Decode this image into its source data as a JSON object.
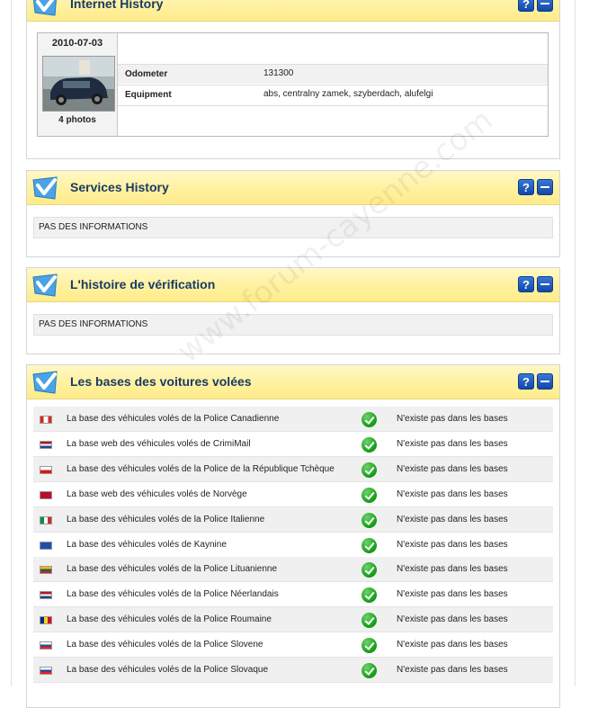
{
  "panels": {
    "internet": {
      "title": "Internet History",
      "date": "2010-07-03",
      "photos": "4 photos",
      "rows": [
        {
          "key": "Odometer",
          "value": "131300"
        },
        {
          "key": "Equipment",
          "value": "abs, centralny zamek, szyberdach, alufelgi"
        }
      ]
    },
    "services": {
      "title": "Services History",
      "info": "PAS DES INFORMATIONS"
    },
    "verification": {
      "title": "L'histoire de vérification",
      "info": "PAS DES INFORMATIONS"
    },
    "stolen": {
      "title": "Les bases des voitures volées",
      "rows": [
        {
          "flag": "canada",
          "name": "La base des véhicules volés de la Police Canadienne",
          "status": "N'existe pas dans les bases"
        },
        {
          "flag": "netherlands",
          "name": "La base web des véhicules volés de CrimiMail",
          "status": "N'existe pas dans les bases"
        },
        {
          "flag": "czech",
          "name": "La base des véhicules volés de la Police de la République Tchèque",
          "status": "N'existe pas dans les bases"
        },
        {
          "flag": "norway",
          "name": "La base web des véhicules volés de Norvège",
          "status": "N'existe pas dans les bases"
        },
        {
          "flag": "italy",
          "name": "La base des véhicules volés de la Police Italienne",
          "status": "N'existe pas dans les bases"
        },
        {
          "flag": "k9",
          "name": "La base des véhicules volés de Kaynine",
          "status": "N'existe pas dans les bases"
        },
        {
          "flag": "lithuania",
          "name": "La base des véhicules volés de la Police Lituanienne",
          "status": "N'existe pas dans les bases"
        },
        {
          "flag": "netherlands",
          "name": "La base des véhicules volés de la Police Néerlandais",
          "status": "N'existe pas dans les bases"
        },
        {
          "flag": "romania",
          "name": "La base des véhicules volés de la Police Roumaine",
          "status": "N'existe pas dans les bases"
        },
        {
          "flag": "slovenia",
          "name": "La base des véhicules volés de la Police Slovene",
          "status": "N'existe pas dans les bases"
        },
        {
          "flag": "slovakia",
          "name": "La base des véhicules volés de la Police Slovaque",
          "status": "N'existe pas dans les bases"
        }
      ]
    }
  },
  "watermark": "www.forum-cayenne.com",
  "buttons": {
    "help": "?"
  },
  "colors": {
    "title": "#1a3a66",
    "header_bg": "#fff1a0",
    "accent": "#1148a8",
    "ok": "#139a13"
  }
}
